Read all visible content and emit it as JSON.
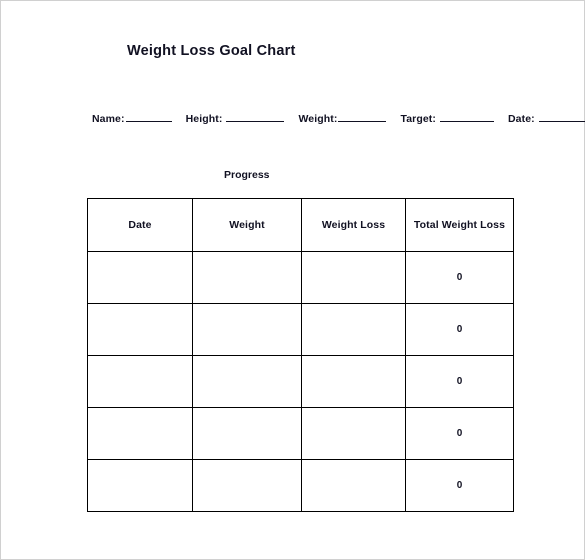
{
  "document": {
    "title": "Weight Loss Goal Chart"
  },
  "form": {
    "fields": [
      {
        "label": "Name:",
        "value": "",
        "blank_class": "blank-name"
      },
      {
        "label": "Height:",
        "value": "",
        "blank_class": "blank-height"
      },
      {
        "label": "Weight:",
        "value": "",
        "blank_class": "blank-weight"
      },
      {
        "label": "Target:",
        "value": "",
        "blank_class": "blank-target"
      },
      {
        "label": "Date:",
        "value": "",
        "blank_class": "blank-date"
      }
    ],
    "name_label": "Name:",
    "height_label": "Height:",
    "weight_label": "Weight:",
    "target_label": "Target:",
    "date_label": "Date:",
    "name_value": "",
    "height_value": "",
    "weight_value": "",
    "target_value": "",
    "date_value": ""
  },
  "section": {
    "progress_caption": "Progress"
  },
  "table": {
    "headers": {
      "date": "Date",
      "weight": "Weight",
      "weight_loss": "Weight Loss",
      "total_weight_loss": "Total Weight Loss"
    },
    "rows": [
      {
        "date": "",
        "weight": "",
        "weight_loss": "",
        "total_weight_loss": "0"
      },
      {
        "date": "",
        "weight": "",
        "weight_loss": "",
        "total_weight_loss": "0"
      },
      {
        "date": "",
        "weight": "",
        "weight_loss": "",
        "total_weight_loss": "0"
      },
      {
        "date": "",
        "weight": "",
        "weight_loss": "",
        "total_weight_loss": "0"
      },
      {
        "date": "",
        "weight": "",
        "weight_loss": "",
        "total_weight_loss": "0"
      }
    ]
  },
  "chart_data": {
    "type": "table",
    "title": "Weight Loss Goal Chart",
    "subtitle": "Progress",
    "columns": [
      "Date",
      "Weight",
      "Weight Loss",
      "Total Weight Loss"
    ],
    "rows": [
      [
        "",
        "",
        "",
        "0"
      ],
      [
        "",
        "",
        "",
        "0"
      ],
      [
        "",
        "",
        "",
        "0"
      ],
      [
        "",
        "",
        "",
        "0"
      ],
      [
        "",
        "",
        "",
        "0"
      ]
    ],
    "values": [
      0,
      0,
      0,
      0,
      0
    ],
    "xlabel": "",
    "ylabel": "Total Weight Loss"
  },
  "colors": {
    "text": "#111122",
    "border": "#000000",
    "page_border": "#d0d0d0",
    "background": "#ffffff"
  }
}
